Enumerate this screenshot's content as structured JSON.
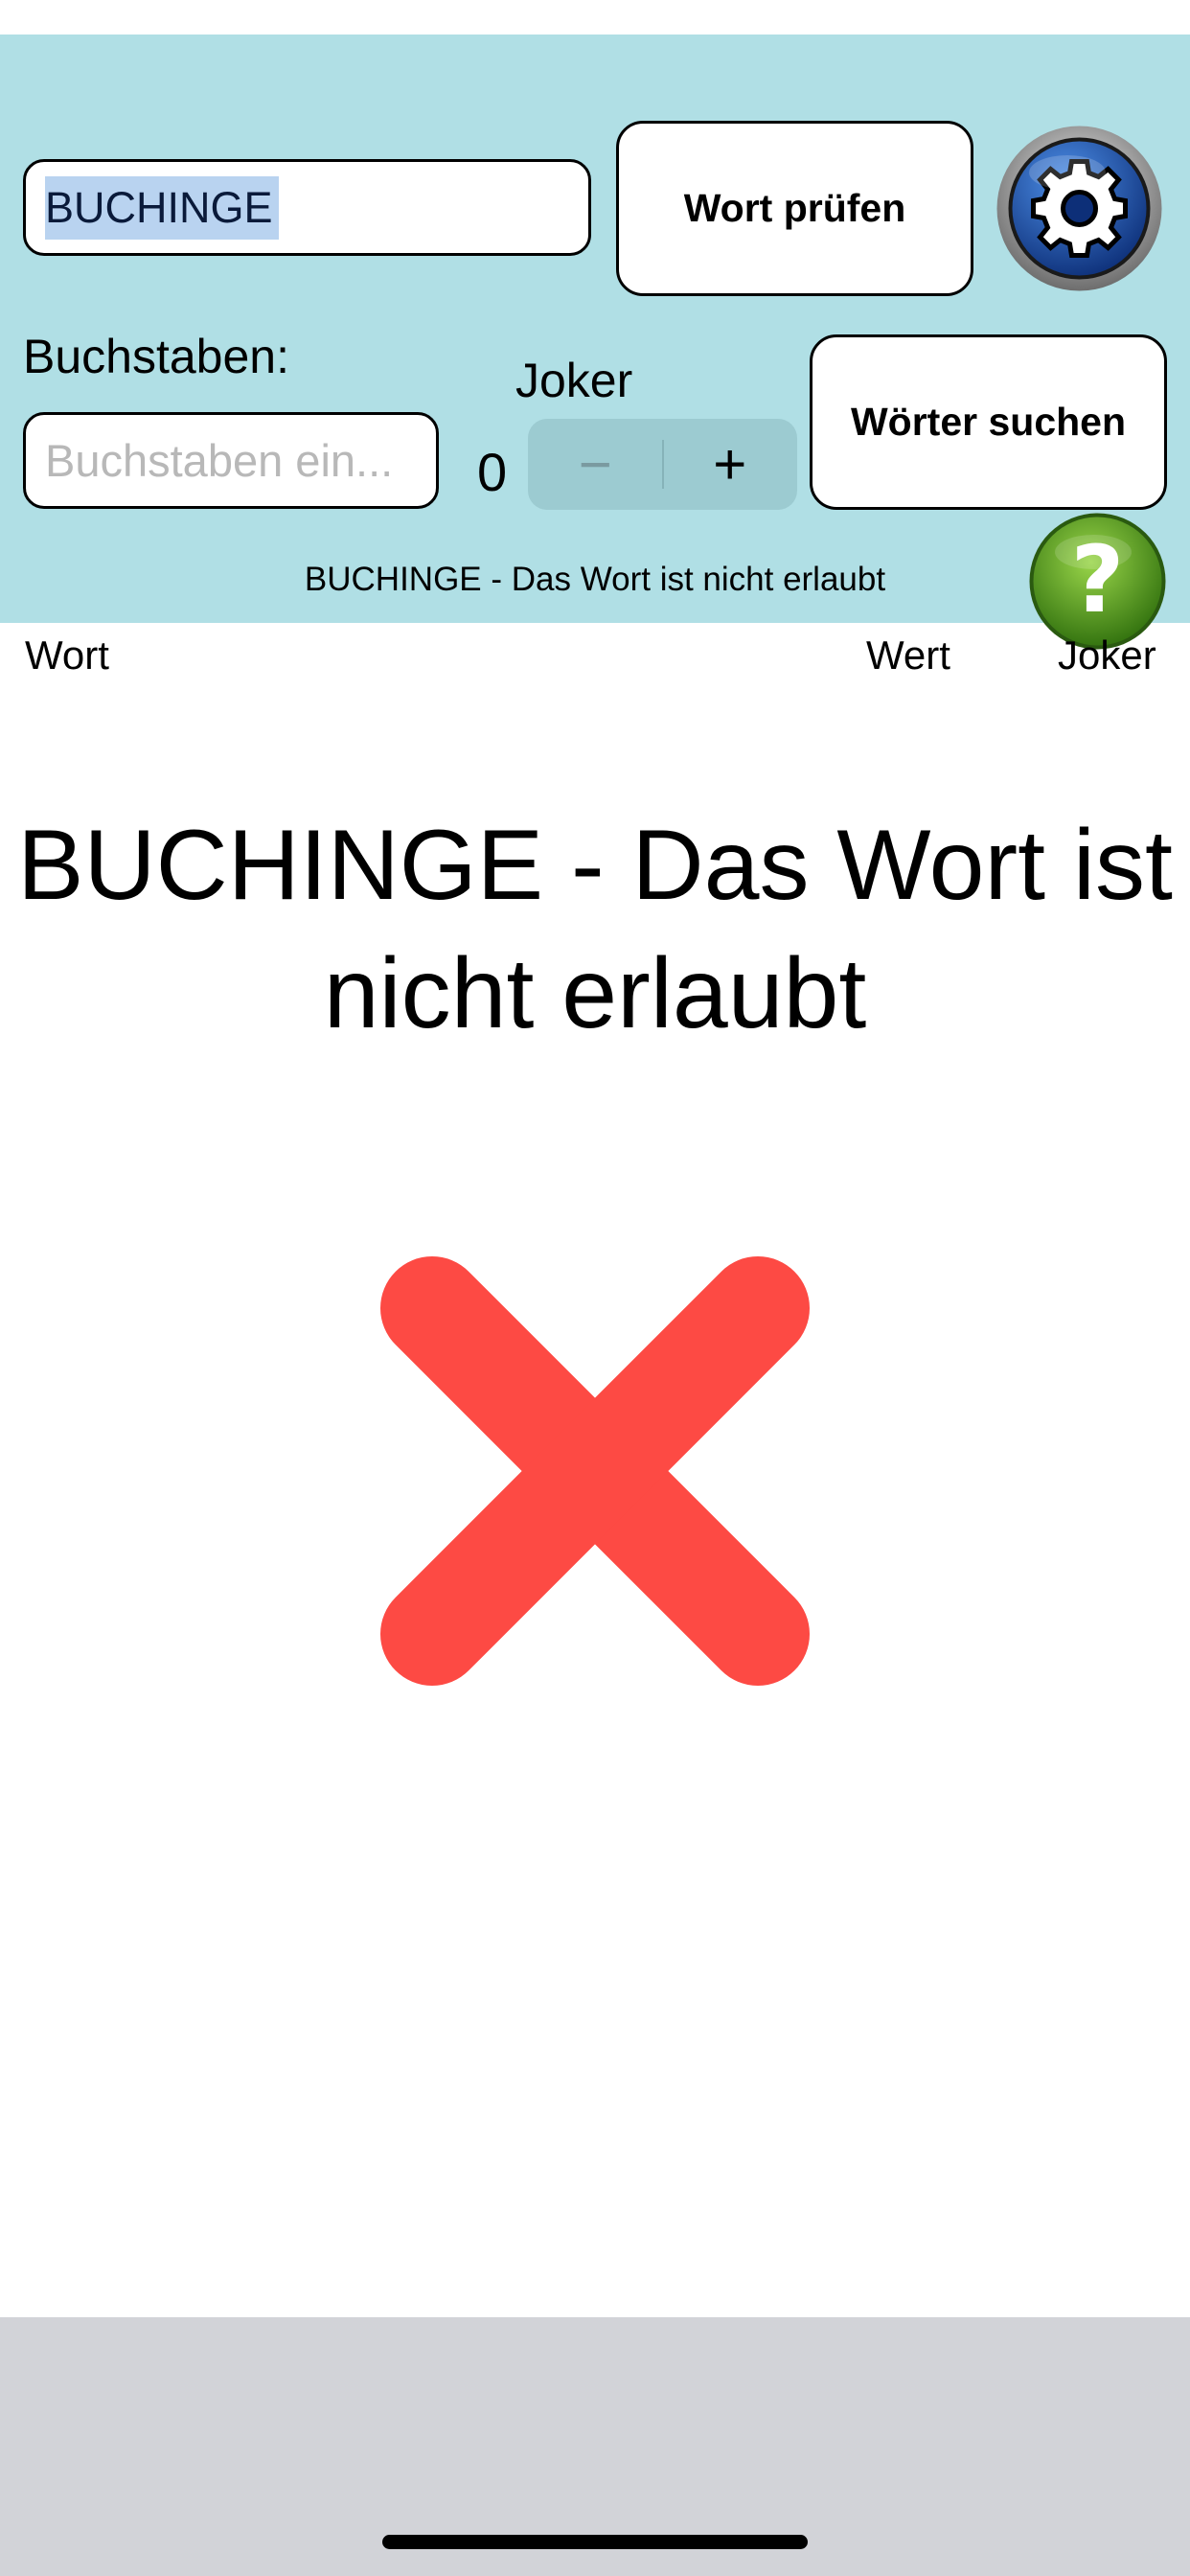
{
  "header": {
    "word_input_value": "BUCHINGE",
    "check_button_label": "Wort prüfen",
    "letters_label": "Buchstaben:",
    "letters_placeholder": "Buchstaben ein...",
    "joker_label": "Joker",
    "joker_count": "0",
    "stepper_minus": "−",
    "stepper_plus": "+",
    "search_button_label": "Wörter suchen",
    "status_message": "BUCHINGE - Das Wort ist nicht erlaubt",
    "settings_icon": "gear-icon",
    "help_icon": "question-mark-icon"
  },
  "results": {
    "columns": [
      "Wort",
      "Wert",
      "Joker"
    ],
    "message_line1": "BUCHINGE - Das Wort ist",
    "message_line2": "nicht erlaubt",
    "result_icon": "red-x-icon"
  },
  "colors": {
    "panel_bg": "#b0dfe5",
    "error_red": "#fd4a44",
    "bottom_bar": "#d2d3d8",
    "help_green": "#5ca21c",
    "settings_blue": "#1b4fa8"
  }
}
